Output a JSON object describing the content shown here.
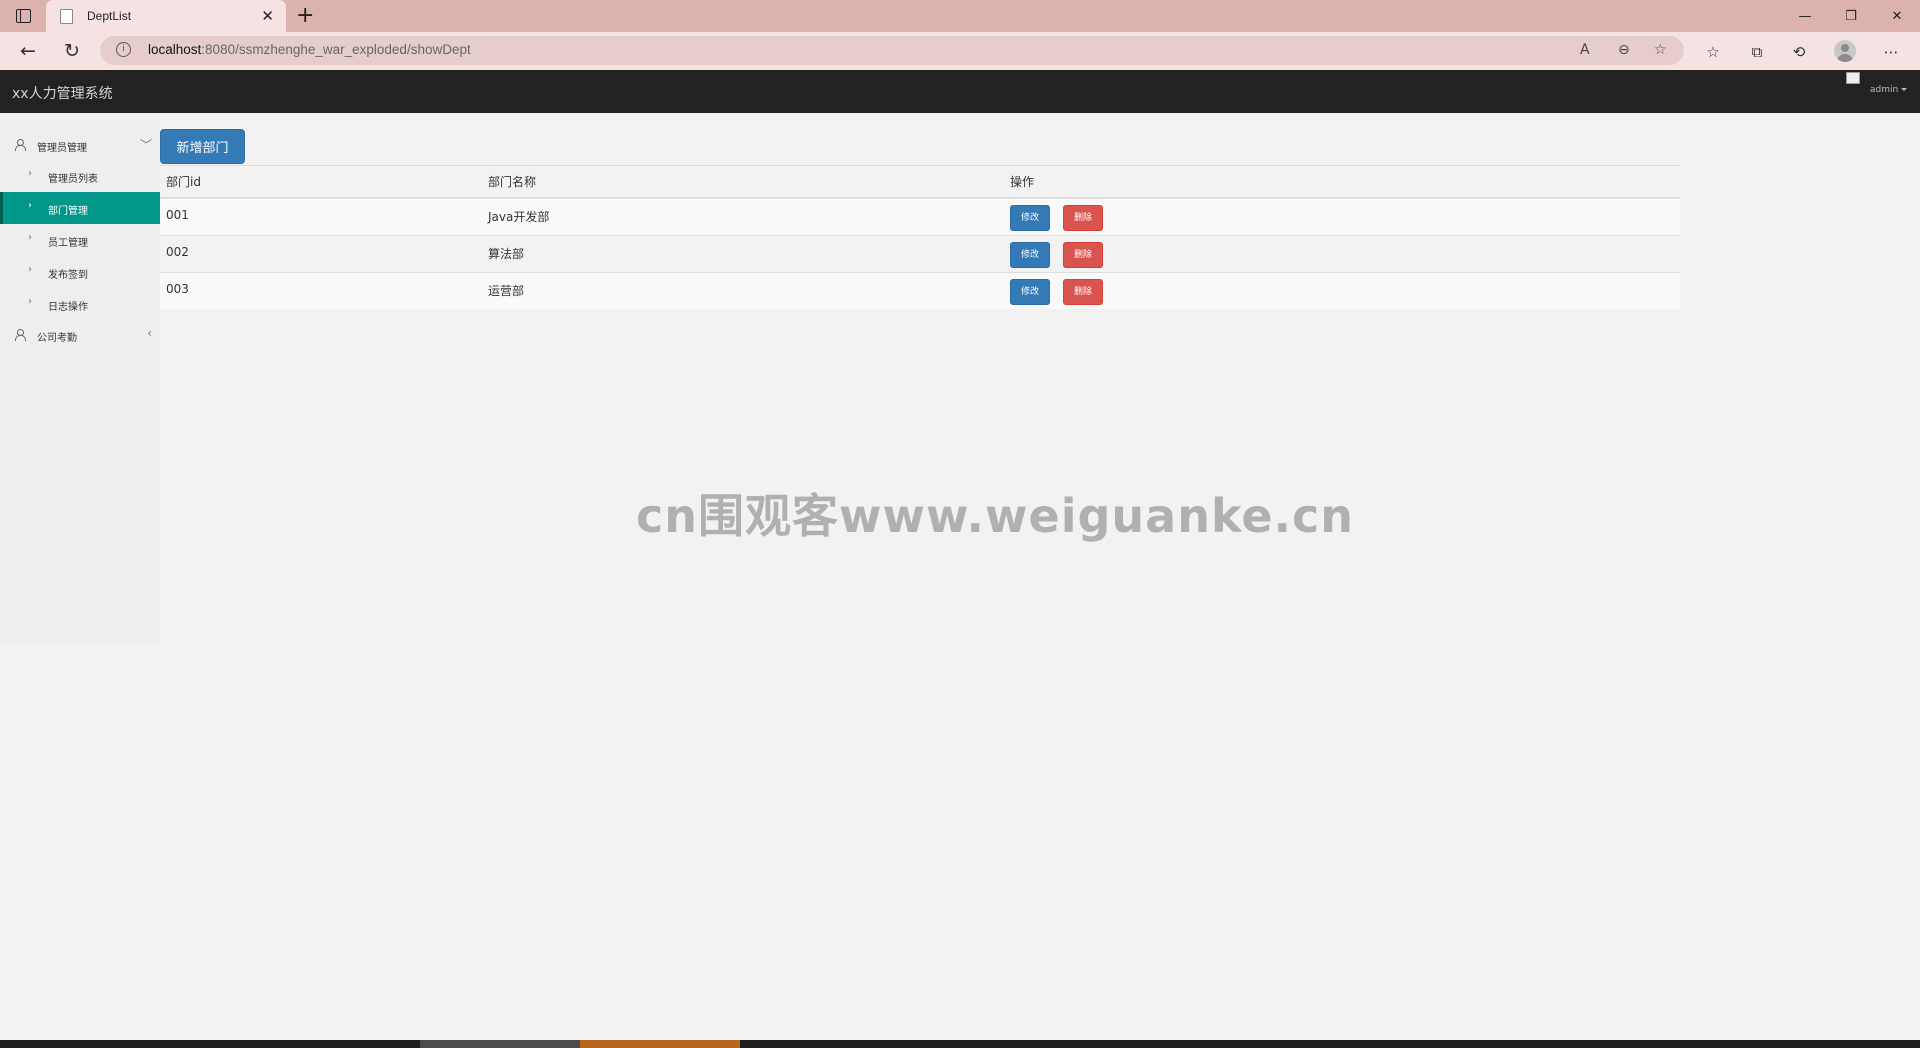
{
  "browser": {
    "tab_title": "DeptList",
    "new_tab_symbol": "+",
    "url_host": "localhost",
    "url_rest": ":8080/ssmzhenghe_war_exploded/showDept"
  },
  "app": {
    "title": "xx人力管理系统",
    "user": "admin"
  },
  "sidebar": {
    "groups": [
      {
        "label": "管理员管理",
        "items": [
          "管理员列表",
          "部门管理",
          "员工管理",
          "发布签到",
          "日志操作"
        ]
      },
      {
        "label": "公司考勤",
        "items": []
      }
    ],
    "active_item": "部门管理"
  },
  "toolbar": {
    "add_label": "新增部门"
  },
  "table": {
    "headers": [
      "部门id",
      "部门名称",
      "操作"
    ],
    "rows": [
      {
        "id": "001",
        "name": "Java开发部"
      },
      {
        "id": "002",
        "name": "算法部"
      },
      {
        "id": "003",
        "name": "运营部"
      }
    ],
    "edit_label": "修改",
    "delete_label": "删除"
  },
  "watermark": "cn围观客www.weiguanke.cn",
  "colors": {
    "primary": "#337ab7",
    "danger": "#d9534f",
    "active_menu": "#009688",
    "header_bg": "#222222",
    "tabbar_bg": "#dbb2ad"
  }
}
